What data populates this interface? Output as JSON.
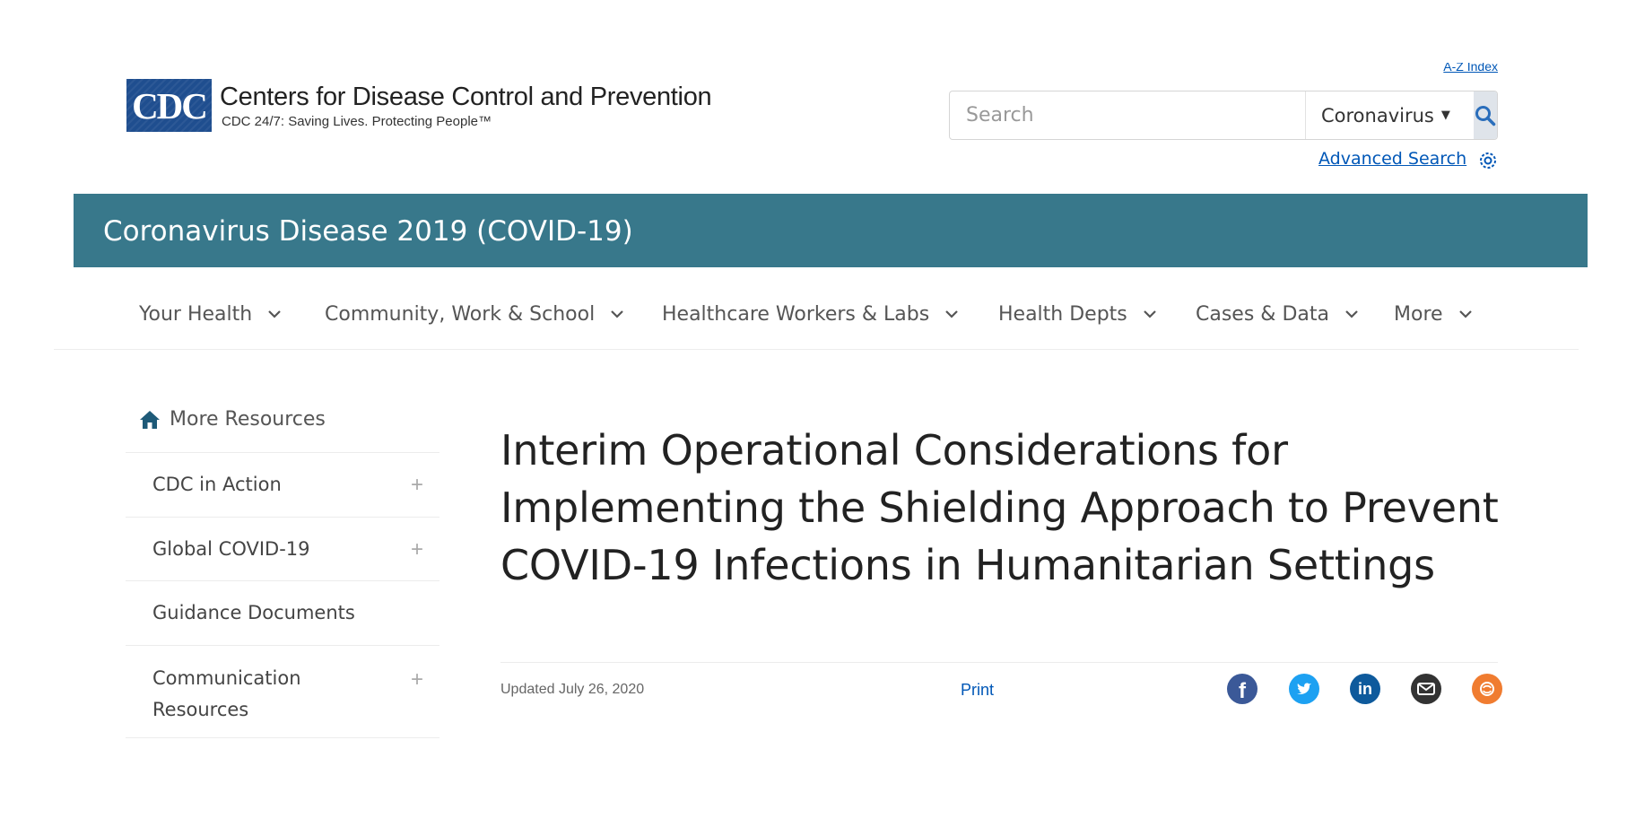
{
  "header": {
    "logo_text": "CDC",
    "org_name": "Centers for Disease Control and Prevention",
    "tagline": "CDC 24/7: Saving Lives. Protecting People™",
    "az_index": "A-Z Index",
    "search_placeholder": "Search",
    "search_scope": "Coronavirus",
    "advanced_search": "Advanced Search"
  },
  "banner": {
    "title": "Coronavirus Disease 2019 (COVID-19)",
    "color": "#38788b"
  },
  "nav": {
    "items": [
      {
        "label": "Your Health"
      },
      {
        "label": "Community, Work & School"
      },
      {
        "label": "Healthcare Workers & Labs"
      },
      {
        "label": "Health Depts"
      },
      {
        "label": "Cases & Data"
      },
      {
        "label": "More"
      }
    ]
  },
  "sidebar": {
    "heading": "More Resources",
    "items": [
      {
        "label": "CDC in Action",
        "expandable": true
      },
      {
        "label": "Global COVID-19",
        "expandable": true
      },
      {
        "label": "Guidance Documents",
        "expandable": false
      },
      {
        "label_line1": "Communication",
        "label_line2": "Resources",
        "expandable": true
      }
    ]
  },
  "main": {
    "title": "Interim Operational Considerations for Implementing the Shielding Approach to Prevent COVID-19 Infections in Humanitarian Settings",
    "updated": "Updated July 26, 2020",
    "print": "Print",
    "share_icons": [
      "facebook-icon",
      "twitter-icon",
      "linkedin-icon",
      "email-icon",
      "syndicate-icon"
    ]
  },
  "colors": {
    "accent_link": "#0057b7",
    "facebook": "#3b5998",
    "twitter": "#1da1f2",
    "linkedin": "#0e5a9c",
    "email": "#333333",
    "syndicate": "#f07c30"
  }
}
